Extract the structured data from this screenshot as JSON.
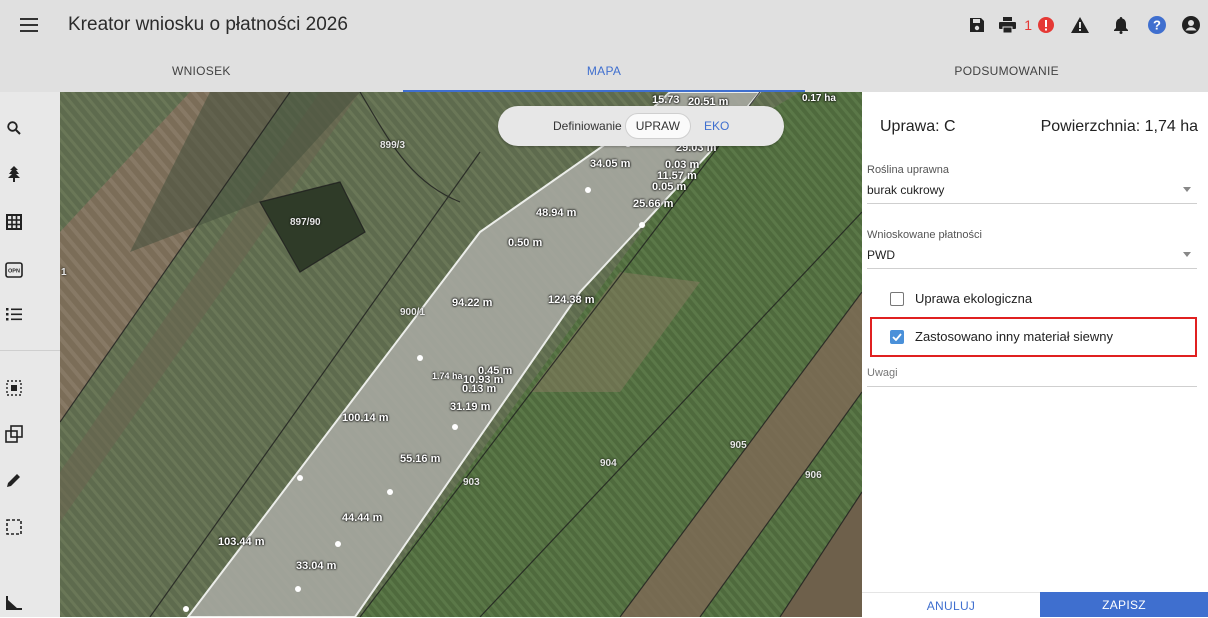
{
  "app": {
    "title": "Kreator wniosku o płatności 2026",
    "notification_count": "1",
    "icons": [
      "menu-icon",
      "save-icon",
      "print-icon",
      "error-icon",
      "warning-icon",
      "bell-icon",
      "help-icon",
      "account-icon"
    ]
  },
  "tabs": [
    {
      "label": "WNIOSEK",
      "active": false
    },
    {
      "label": "MAPA",
      "active": true
    },
    {
      "label": "PODSUMOWANIE",
      "active": false
    }
  ],
  "tools": [
    "search-icon",
    "tree-icon",
    "grid-icon",
    "opn-icon",
    "list-icon",
    "select-object-icon",
    "copy-shape-icon",
    "pencil-icon",
    "selection-box-icon",
    "measure-icon"
  ],
  "map": {
    "toggle": {
      "label": "Definiowanie",
      "options": [
        "UPRAW",
        "EKO"
      ],
      "selected": "UPRAW"
    },
    "parcels": [
      "899/3",
      "897/90",
      "900/1",
      "903",
      "904",
      "905",
      "906",
      "1"
    ],
    "measurements": [
      "15.73",
      "20.51 m",
      "0.17 ha",
      "29.03 m",
      "34.05 m",
      "0.03 m",
      "11.57 m",
      "0.05 m",
      "25.66 m",
      "48.94 m",
      "0.50 m",
      "94.22 m",
      "124.38 m",
      "1.74 ha",
      "10.93 m",
      "0.45 m",
      "0.13 m",
      "31.19 m",
      "100.14 m",
      "55.16 m",
      "44.44 m",
      "103.44 m",
      "33.04 m"
    ]
  },
  "panel": {
    "crop_label": "Uprawa: C",
    "area_label": "Powierzchnia: 1,74 ha",
    "plant_label": "Roślina uprawna",
    "plant_value": "burak cukrowy",
    "payments_label": "Wnioskowane płatności",
    "payments_value": "PWD",
    "eco_label": "Uprawa ekologiczna",
    "eco_checked": false,
    "seed_label": "Zastosowano inny materiał siewny",
    "seed_checked": true,
    "notes_placeholder": "Uwagi",
    "cancel_label": "ANULUJ",
    "save_label": "ZAPISZ"
  },
  "colors": {
    "accent": "#3f6fcf",
    "error": "#e53935",
    "highlight": "#e02020",
    "checkbox": "#4a90d9"
  }
}
